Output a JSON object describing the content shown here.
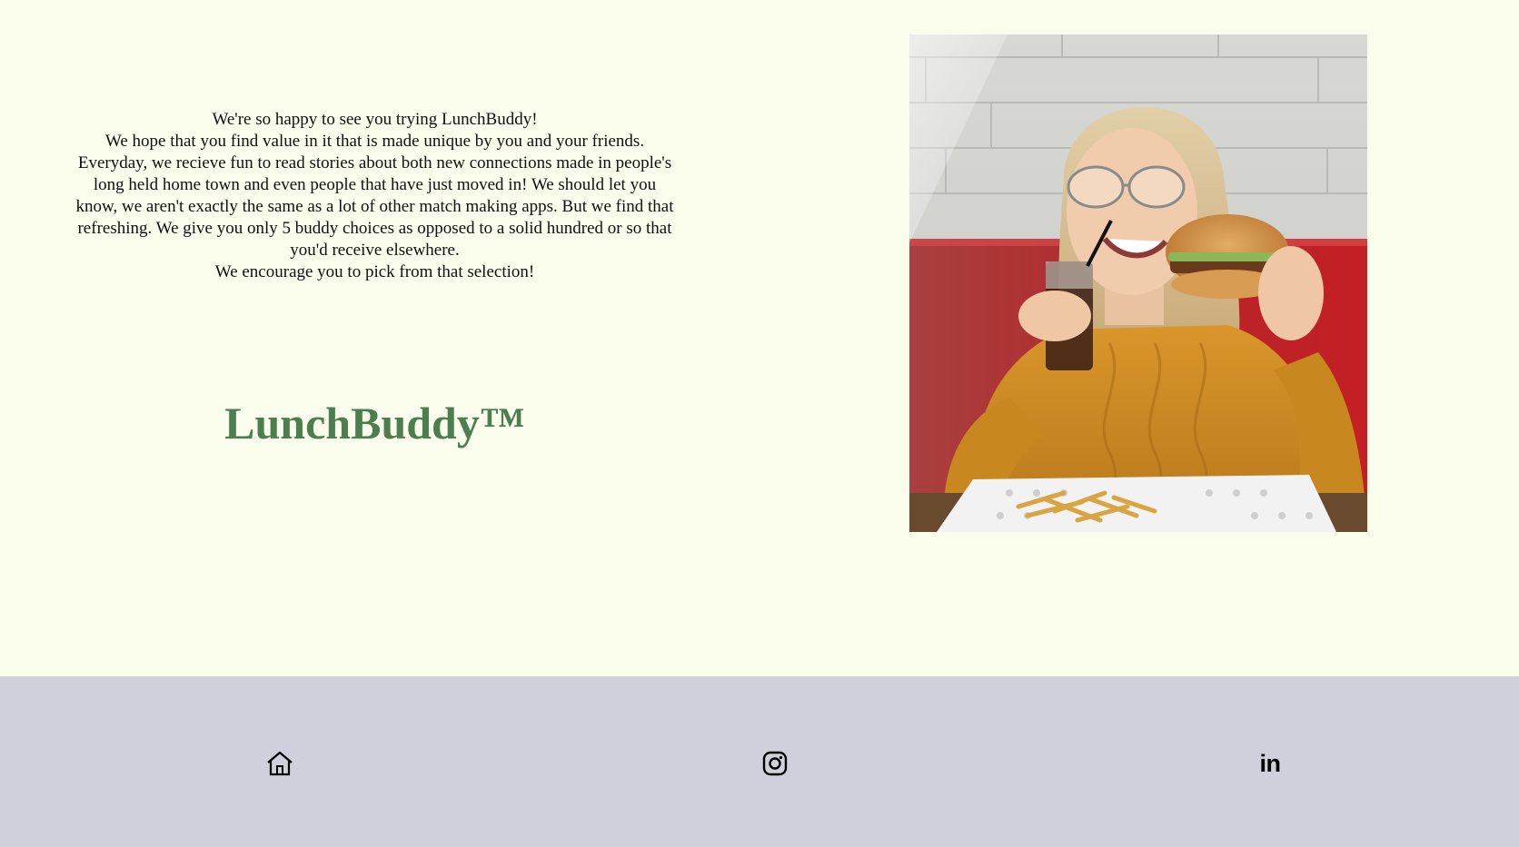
{
  "intro": {
    "lines": [
      "We're so happy to see you trying LunchBuddy!",
      "We hope that you find value in it that is made unique by you and your friends.",
      "Everyday, we recieve fun to read stories about both new connections made in people's long held home town and even people that have just moved in! We should let you know, we aren't exactly the same as a lot of other match making apps. But we find that refreshing. We give you only 5 buddy choices as opposed to a solid hundred or so that you'd receive elsewhere.",
      "We encourage you to pick from that selection!"
    ]
  },
  "brand": {
    "name": "LunchBuddy™",
    "color": "#4c7e50"
  },
  "hero_image": {
    "icon": "woman-eating-burger-photo"
  },
  "footer": {
    "background": "#d0d0dc",
    "icons": [
      {
        "name": "home-icon"
      },
      {
        "name": "instagram-icon"
      },
      {
        "name": "linkedin-icon",
        "text": "in"
      }
    ]
  },
  "colors": {
    "page_background": "#fafcec",
    "text": "#111111"
  }
}
